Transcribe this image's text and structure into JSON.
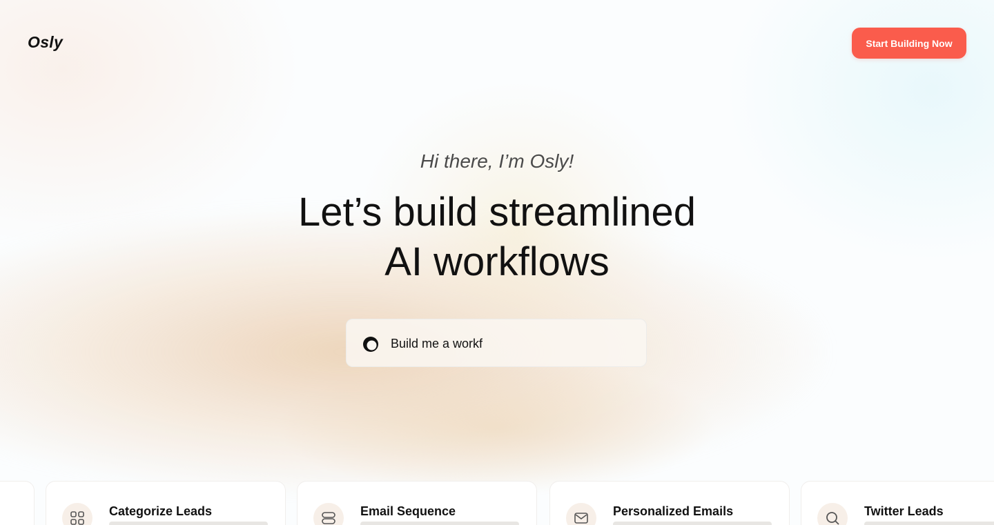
{
  "header": {
    "logo": "Osly",
    "cta_label": "Start Building Now"
  },
  "hero": {
    "greeting": "Hi there, I’m Osly!",
    "headline_line1": "Let’s build streamlined",
    "headline_line2": "AI workflows"
  },
  "prompt": {
    "typed_text": "Build me a workf",
    "icon": "osly-logo-icon"
  },
  "cards": [
    {
      "title": "Categorize Leads",
      "icon": "grid-icon"
    },
    {
      "title": "Email Sequence",
      "icon": "database-icon"
    },
    {
      "title": "Personalized Emails",
      "icon": "mail-icon"
    },
    {
      "title": "Twitter Leads",
      "icon": "search-icon"
    }
  ],
  "colors": {
    "accent": "#fa5c4c",
    "text": "#111111",
    "greeting": "#4a4a4a",
    "icon_bg": "#f7efe8"
  }
}
